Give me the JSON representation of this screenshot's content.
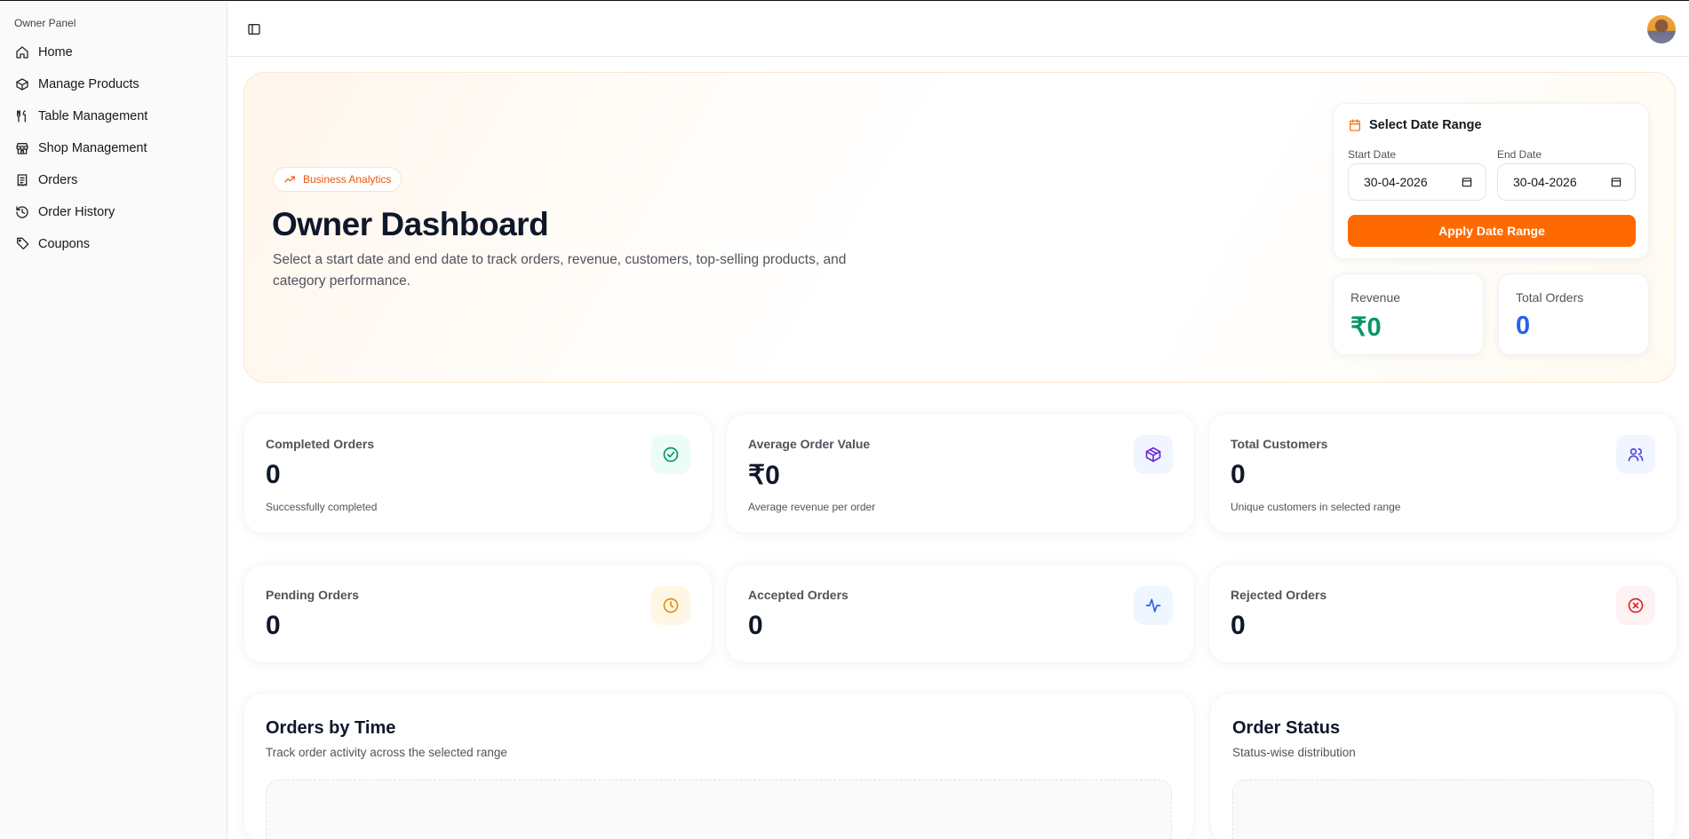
{
  "sidebar": {
    "group_label": "Owner Panel",
    "items": [
      {
        "label": "Home",
        "icon": "home-icon"
      },
      {
        "label": "Manage Products",
        "icon": "package-icon"
      },
      {
        "label": "Table Management",
        "icon": "utensils-icon"
      },
      {
        "label": "Shop Management",
        "icon": "store-icon"
      },
      {
        "label": "Orders",
        "icon": "receipt-icon"
      },
      {
        "label": "Order History",
        "icon": "history-icon"
      },
      {
        "label": "Coupons",
        "icon": "tag-icon"
      }
    ]
  },
  "hero": {
    "badge": "Business Analytics",
    "title": "Owner Dashboard",
    "description": "Select a start date and end date to track orders, revenue, customers, top-selling products, and category performance."
  },
  "date_range": {
    "title": "Select Date Range",
    "start_label": "Start Date",
    "start_value": "30-04-2026",
    "end_label": "End Date",
    "end_value": "30-04-2026",
    "apply_label": "Apply Date Range"
  },
  "summary": {
    "revenue_label": "Revenue",
    "revenue_value": "₹0",
    "orders_label": "Total Orders",
    "orders_value": "0"
  },
  "stats": [
    {
      "label": "Completed Orders",
      "value": "0",
      "sub": "Successfully completed",
      "icon": "check-circle-icon"
    },
    {
      "label": "Average Order Value",
      "value": "₹0",
      "sub": "Average revenue per order",
      "icon": "package-icon"
    },
    {
      "label": "Total Customers",
      "value": "0",
      "sub": "Unique customers in selected range",
      "icon": "users-icon"
    },
    {
      "label": "Pending Orders",
      "value": "0",
      "icon": "clock-icon"
    },
    {
      "label": "Accepted Orders",
      "value": "0",
      "icon": "activity-icon"
    },
    {
      "label": "Rejected Orders",
      "value": "0",
      "icon": "x-circle-icon"
    }
  ],
  "charts": {
    "orders_by_time": {
      "title": "Orders by Time",
      "subtitle": "Track order activity across the selected range"
    },
    "order_status": {
      "title": "Order Status",
      "subtitle": "Status-wise distribution"
    }
  },
  "colors": {
    "accent": "#ff6a00",
    "revenue": "#059669",
    "orders": "#2563eb"
  }
}
